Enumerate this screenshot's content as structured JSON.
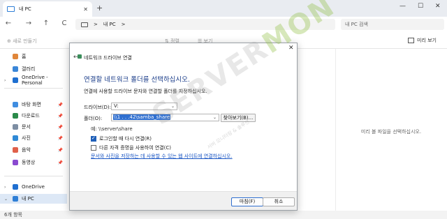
{
  "window": {
    "tab_title": "내 PC",
    "new_tab": "+",
    "tab_close": "✕",
    "controls": [
      "—",
      "☐",
      "✕"
    ]
  },
  "nav": {
    "back": "←",
    "forward": "→",
    "up": "↑",
    "refresh": "C",
    "address_crumb": "내 PC",
    "address_chevron": ">",
    "search_placeholder": "내 PC 검색"
  },
  "commandbar": {
    "new_label": "새로 만들기",
    "sort_label": "정렬",
    "view_label": "보기",
    "preview_label": "미리 보기"
  },
  "sidebar": {
    "items": [
      {
        "label": "홈",
        "icon": "home-icon",
        "color": "#e0863a",
        "pinned": false
      },
      {
        "label": "갤러리",
        "icon": "gallery-icon",
        "color": "#3a86d8",
        "pinned": false
      },
      {
        "label": "OneDrive - Personal",
        "icon": "onedrive-icon",
        "color": "#1f6fd0",
        "pinned": false
      },
      {
        "label": "바탕 화면",
        "icon": "desktop-icon",
        "color": "#3f8de0",
        "pinned": true
      },
      {
        "label": "다운로드",
        "icon": "download-icon",
        "color": "#2a8a4a",
        "pinned": true
      },
      {
        "label": "문서",
        "icon": "document-icon",
        "color": "#7d8ea3",
        "pinned": true
      },
      {
        "label": "사진",
        "icon": "pictures-icon",
        "color": "#2f89d6",
        "pinned": true
      },
      {
        "label": "음악",
        "icon": "music-icon",
        "color": "#e0604a",
        "pinned": true
      },
      {
        "label": "동영상",
        "icon": "video-icon",
        "color": "#8a4ad0",
        "pinned": true
      },
      {
        "label": "OneDrive",
        "icon": "onedrive-icon",
        "color": "#1f6fd0",
        "pinned": false
      },
      {
        "label": "내 PC",
        "icon": "pc-icon",
        "color": "#2f7fd6",
        "pinned": false
      }
    ],
    "pin_glyph": "📌"
  },
  "preview": {
    "message": "미리 볼 파일을 선택하십시오."
  },
  "status": {
    "item_count": "6개 항목"
  },
  "dialog": {
    "title": "네트워크 드라이브 연결",
    "heading": "연결할 네트워크 폴더를 선택하십시오.",
    "description": "연결에 사용할 드라이브 문자와 연결할 폴더를 지정하십시오.",
    "drive_label": "드라이브(D):",
    "drive_value": "V:",
    "folder_label": "폴더(O):",
    "folder_value": "\\\\1 . . .42\\samba_share",
    "browse_button": "찾아보기(B)...",
    "example": "예: \\\\server\\share",
    "reconnect_label": "로그인할 때 다시 연결(R)",
    "reconnect_checked": true,
    "other_creds_label": "다른 자격 증명을 사용하여 연결(C)",
    "other_creds_checked": false,
    "link_text": "문서와 사진을 저장하는 데 사용할 수 있는 웹 사이트에 연결하십시오.",
    "finish_button": "마침(F)",
    "cancel_button": "취소",
    "close": "✕",
    "back": "←"
  },
  "watermark": {
    "brand_a": "SERVER",
    "brand_b": "MON",
    "tagline": "서버 모니터링 & 솔루션"
  }
}
